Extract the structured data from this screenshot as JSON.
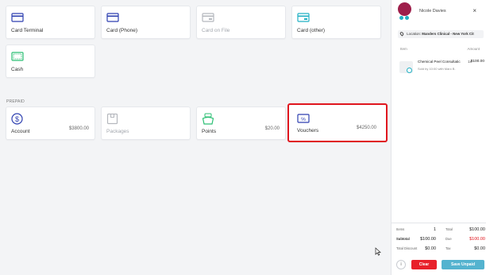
{
  "payment_methods": [
    {
      "label": "Card Terminal",
      "icon": "card-icon"
    },
    {
      "label": "Card (Phone)",
      "icon": "card-icon"
    },
    {
      "label": "Card on File",
      "icon": "card-icon"
    },
    {
      "label": "Card (other)",
      "icon": "card-icon"
    },
    {
      "label": "Cash",
      "icon": "cash-icon"
    }
  ],
  "prepaid": {
    "section_label": "PREPAID",
    "items": [
      {
        "label": "Account",
        "amount": "$3800.00",
        "icon": "dollar-icon"
      },
      {
        "label": "Packages",
        "amount": "",
        "icon": "package-icon"
      },
      {
        "label": "Points",
        "amount": "$20.00",
        "icon": "points-icon"
      },
      {
        "label": "Vouchers",
        "amount": "$4250.00",
        "icon": "voucher-icon"
      }
    ]
  },
  "sidebar": {
    "customer_name": "Nicole Davies",
    "close_glyph": "×",
    "location_prefix": "Location:",
    "location_name": "Manders Clinical - New York Cit",
    "col_item": "Item",
    "col_amount": "Amount",
    "line_item": {
      "name": "Chemical Peel Consultatic",
      "sub": "Sold by 10:00 with Marc B.",
      "qty": "1x",
      "amount": "$100.00"
    },
    "totals": {
      "items_label": "Items",
      "items_value": "1",
      "total_label": "Total",
      "total_value": "$100.00",
      "subtotal_label": "Subtotal",
      "subtotal_value": "$100.00",
      "due_label": "Due",
      "due_value": "$100.00",
      "discount_label": "Total Discount",
      "discount_value": "$0.00",
      "tax_label": "Tax",
      "tax_value": "$0.00"
    },
    "info_glyph": "i",
    "clear_label": "Clear",
    "save_label": "Save Unpaid"
  },
  "colors": {
    "accent_blue": "#2d3fb0",
    "teal": "#21b0c4",
    "green": "#2bbf73",
    "red": "#e0161e"
  }
}
